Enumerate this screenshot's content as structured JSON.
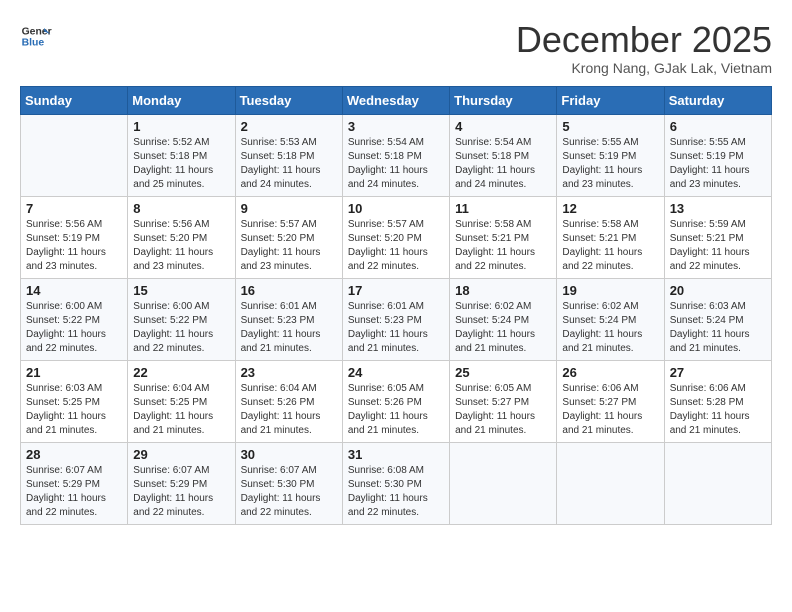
{
  "header": {
    "logo_line1": "General",
    "logo_line2": "Blue",
    "month": "December 2025",
    "location": "Krong Nang, GJak Lak, Vietnam"
  },
  "weekdays": [
    "Sunday",
    "Monday",
    "Tuesday",
    "Wednesday",
    "Thursday",
    "Friday",
    "Saturday"
  ],
  "weeks": [
    [
      {
        "day": "",
        "info": ""
      },
      {
        "day": "1",
        "info": "Sunrise: 5:52 AM\nSunset: 5:18 PM\nDaylight: 11 hours\nand 25 minutes."
      },
      {
        "day": "2",
        "info": "Sunrise: 5:53 AM\nSunset: 5:18 PM\nDaylight: 11 hours\nand 24 minutes."
      },
      {
        "day": "3",
        "info": "Sunrise: 5:54 AM\nSunset: 5:18 PM\nDaylight: 11 hours\nand 24 minutes."
      },
      {
        "day": "4",
        "info": "Sunrise: 5:54 AM\nSunset: 5:18 PM\nDaylight: 11 hours\nand 24 minutes."
      },
      {
        "day": "5",
        "info": "Sunrise: 5:55 AM\nSunset: 5:19 PM\nDaylight: 11 hours\nand 23 minutes."
      },
      {
        "day": "6",
        "info": "Sunrise: 5:55 AM\nSunset: 5:19 PM\nDaylight: 11 hours\nand 23 minutes."
      }
    ],
    [
      {
        "day": "7",
        "info": "Sunrise: 5:56 AM\nSunset: 5:19 PM\nDaylight: 11 hours\nand 23 minutes."
      },
      {
        "day": "8",
        "info": "Sunrise: 5:56 AM\nSunset: 5:20 PM\nDaylight: 11 hours\nand 23 minutes."
      },
      {
        "day": "9",
        "info": "Sunrise: 5:57 AM\nSunset: 5:20 PM\nDaylight: 11 hours\nand 23 minutes."
      },
      {
        "day": "10",
        "info": "Sunrise: 5:57 AM\nSunset: 5:20 PM\nDaylight: 11 hours\nand 22 minutes."
      },
      {
        "day": "11",
        "info": "Sunrise: 5:58 AM\nSunset: 5:21 PM\nDaylight: 11 hours\nand 22 minutes."
      },
      {
        "day": "12",
        "info": "Sunrise: 5:58 AM\nSunset: 5:21 PM\nDaylight: 11 hours\nand 22 minutes."
      },
      {
        "day": "13",
        "info": "Sunrise: 5:59 AM\nSunset: 5:21 PM\nDaylight: 11 hours\nand 22 minutes."
      }
    ],
    [
      {
        "day": "14",
        "info": "Sunrise: 6:00 AM\nSunset: 5:22 PM\nDaylight: 11 hours\nand 22 minutes."
      },
      {
        "day": "15",
        "info": "Sunrise: 6:00 AM\nSunset: 5:22 PM\nDaylight: 11 hours\nand 22 minutes."
      },
      {
        "day": "16",
        "info": "Sunrise: 6:01 AM\nSunset: 5:23 PM\nDaylight: 11 hours\nand 21 minutes."
      },
      {
        "day": "17",
        "info": "Sunrise: 6:01 AM\nSunset: 5:23 PM\nDaylight: 11 hours\nand 21 minutes."
      },
      {
        "day": "18",
        "info": "Sunrise: 6:02 AM\nSunset: 5:24 PM\nDaylight: 11 hours\nand 21 minutes."
      },
      {
        "day": "19",
        "info": "Sunrise: 6:02 AM\nSunset: 5:24 PM\nDaylight: 11 hours\nand 21 minutes."
      },
      {
        "day": "20",
        "info": "Sunrise: 6:03 AM\nSunset: 5:24 PM\nDaylight: 11 hours\nand 21 minutes."
      }
    ],
    [
      {
        "day": "21",
        "info": "Sunrise: 6:03 AM\nSunset: 5:25 PM\nDaylight: 11 hours\nand 21 minutes."
      },
      {
        "day": "22",
        "info": "Sunrise: 6:04 AM\nSunset: 5:25 PM\nDaylight: 11 hours\nand 21 minutes."
      },
      {
        "day": "23",
        "info": "Sunrise: 6:04 AM\nSunset: 5:26 PM\nDaylight: 11 hours\nand 21 minutes."
      },
      {
        "day": "24",
        "info": "Sunrise: 6:05 AM\nSunset: 5:26 PM\nDaylight: 11 hours\nand 21 minutes."
      },
      {
        "day": "25",
        "info": "Sunrise: 6:05 AM\nSunset: 5:27 PM\nDaylight: 11 hours\nand 21 minutes."
      },
      {
        "day": "26",
        "info": "Sunrise: 6:06 AM\nSunset: 5:27 PM\nDaylight: 11 hours\nand 21 minutes."
      },
      {
        "day": "27",
        "info": "Sunrise: 6:06 AM\nSunset: 5:28 PM\nDaylight: 11 hours\nand 21 minutes."
      }
    ],
    [
      {
        "day": "28",
        "info": "Sunrise: 6:07 AM\nSunset: 5:29 PM\nDaylight: 11 hours\nand 22 minutes."
      },
      {
        "day": "29",
        "info": "Sunrise: 6:07 AM\nSunset: 5:29 PM\nDaylight: 11 hours\nand 22 minutes."
      },
      {
        "day": "30",
        "info": "Sunrise: 6:07 AM\nSunset: 5:30 PM\nDaylight: 11 hours\nand 22 minutes."
      },
      {
        "day": "31",
        "info": "Sunrise: 6:08 AM\nSunset: 5:30 PM\nDaylight: 11 hours\nand 22 minutes."
      },
      {
        "day": "",
        "info": ""
      },
      {
        "day": "",
        "info": ""
      },
      {
        "day": "",
        "info": ""
      }
    ]
  ]
}
